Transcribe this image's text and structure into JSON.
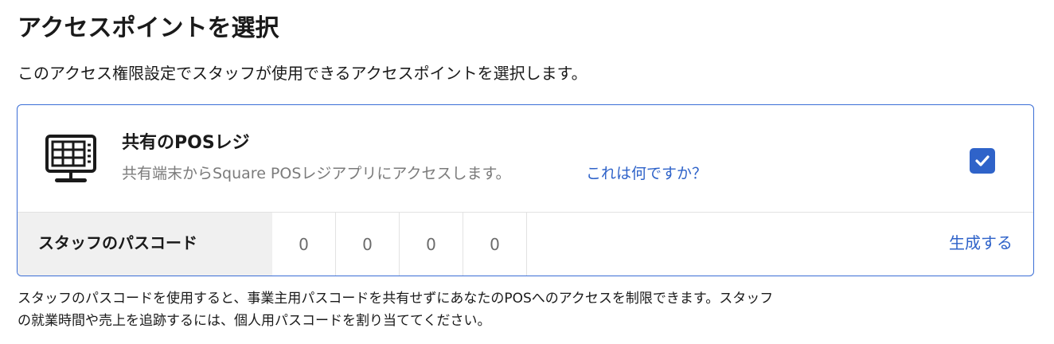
{
  "page": {
    "title": "アクセスポイントを選択",
    "description": "このアクセス権限設定でスタッフが使用できるアクセスポイントを選択します。"
  },
  "option": {
    "icon": "pos-register-icon",
    "title": "共有のPOSレジ",
    "description": "共有端末からSquare POSレジアプリにアクセスします。",
    "help_link": "これは何ですか？",
    "checked": true
  },
  "passcode": {
    "label": "スタッフのパスコード",
    "digits": [
      "0",
      "0",
      "0",
      "0"
    ],
    "generate_label": "生成する"
  },
  "footnote": "スタッフのパスコードを使用すると、事業主用パスコードを共有せずにあなたのPOSへのアクセスを制限できます。スタッフの就業時間や売上を追跡するには、個人用パスコードを割り当ててください。",
  "colors": {
    "accent": "#2f63c9",
    "border": "#3b6ed6",
    "muted_text": "#7b7b7b",
    "label_bg": "#f0f0f0"
  }
}
